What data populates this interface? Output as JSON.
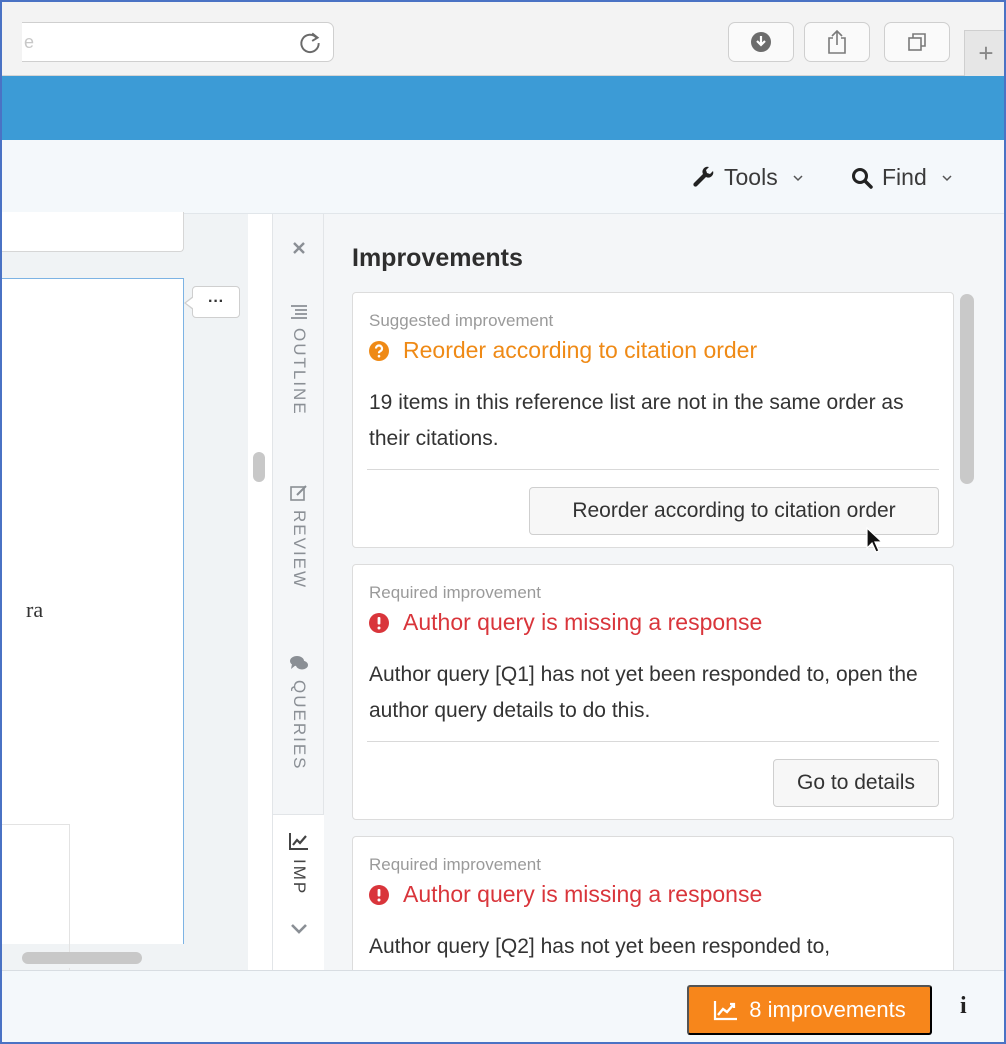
{
  "browser": {
    "url_fragment": "e",
    "new_tab_label": "+"
  },
  "toolbar": {
    "tools_label": "Tools",
    "find_label": "Find"
  },
  "editor": {
    "text_fragment": "ra",
    "more_button": "···"
  },
  "side_tabs": {
    "outline": "OUTLINE",
    "review": "REVIEW",
    "queries": "QUERIES",
    "improvements": "IMP"
  },
  "panel": {
    "title": "Improvements",
    "cards": [
      {
        "kind": "Suggested improvement",
        "title": "Reorder according to citation order",
        "description": "19 items in this reference list are not in the same order as their citations.",
        "action": "Reorder according to citation order",
        "severity": "suggested"
      },
      {
        "kind": "Required improvement",
        "title": "Author query is missing a response",
        "description": "Author query [Q1] has not yet been responded to, open the author query details to do this.",
        "action": "Go to details",
        "severity": "required"
      },
      {
        "kind": "Required improvement",
        "title": "Author query is missing a response",
        "description": "Author query [Q2] has not yet been responded to,",
        "severity": "required"
      }
    ]
  },
  "status_bar": {
    "improvements_button": "8 improvements",
    "info_button": "i"
  },
  "colors": {
    "app_bar": "#3c9bd6",
    "suggested": "#ef8a16",
    "required": "#d9353b",
    "improvements_button": "#f7861b"
  }
}
